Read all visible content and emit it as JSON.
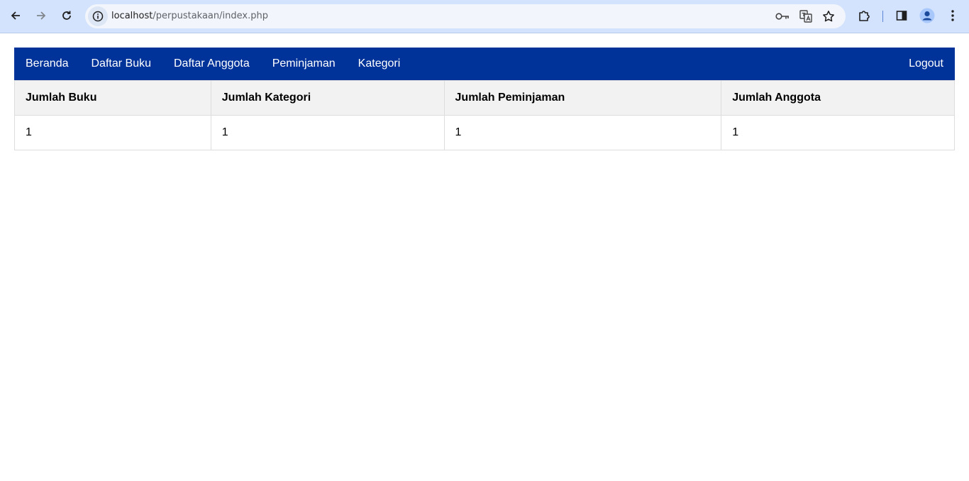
{
  "browser": {
    "url_host": "localhost",
    "url_path": "/perpustakaan/index.php",
    "icons": {
      "back": "arrow-left-icon",
      "forward": "arrow-right-icon",
      "reload": "reload-icon",
      "site_info": "info-icon",
      "password": "key-icon",
      "translate": "translate-icon",
      "bookmark": "star-icon",
      "extensions": "puzzle-icon",
      "side_panel": "side-panel-icon",
      "profile": "profile-icon",
      "menu": "kebab-menu-icon"
    }
  },
  "nav": {
    "items": [
      {
        "label": "Beranda"
      },
      {
        "label": "Daftar Buku"
      },
      {
        "label": "Daftar Anggota"
      },
      {
        "label": "Peminjaman"
      },
      {
        "label": "Kategori"
      }
    ],
    "logout_label": "Logout",
    "background_color": "#003399"
  },
  "stats": {
    "headers": [
      "Jumlah Buku",
      "Jumlah Kategori",
      "Jumlah Peminjaman",
      "Jumlah Anggota"
    ],
    "values": [
      "1",
      "1",
      "1",
      "1"
    ]
  }
}
